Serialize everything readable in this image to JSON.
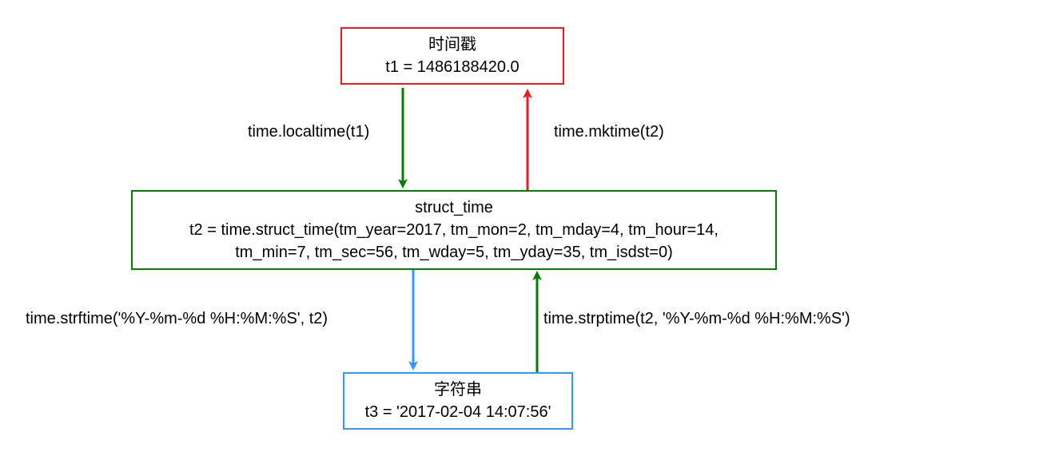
{
  "boxes": {
    "timestamp": {
      "title": "时间戳",
      "value": "t1 = 1486188420.0"
    },
    "struct": {
      "title": "struct_time",
      "value": "t2 = time.struct_time(tm_year=2017, tm_mon=2, tm_mday=4, tm_hour=14,\n tm_min=7, tm_sec=56, tm_wday=5, tm_yday=35, tm_isdst=0)"
    },
    "string": {
      "title": "字符串",
      "value": "t3 = '2017-02-04 14:07:56'"
    }
  },
  "labels": {
    "localtime": "time.localtime(t1)",
    "mktime": "time.mktime(t2)",
    "strftime": "time.strftime('%Y-%m-%d %H:%M:%S', t2)",
    "strptime": "time.strptime(t2, '%Y-%m-%d %H:%M:%S')"
  },
  "colors": {
    "red": "#ed1c24",
    "green": "#008000",
    "blue": "#3399ff"
  }
}
